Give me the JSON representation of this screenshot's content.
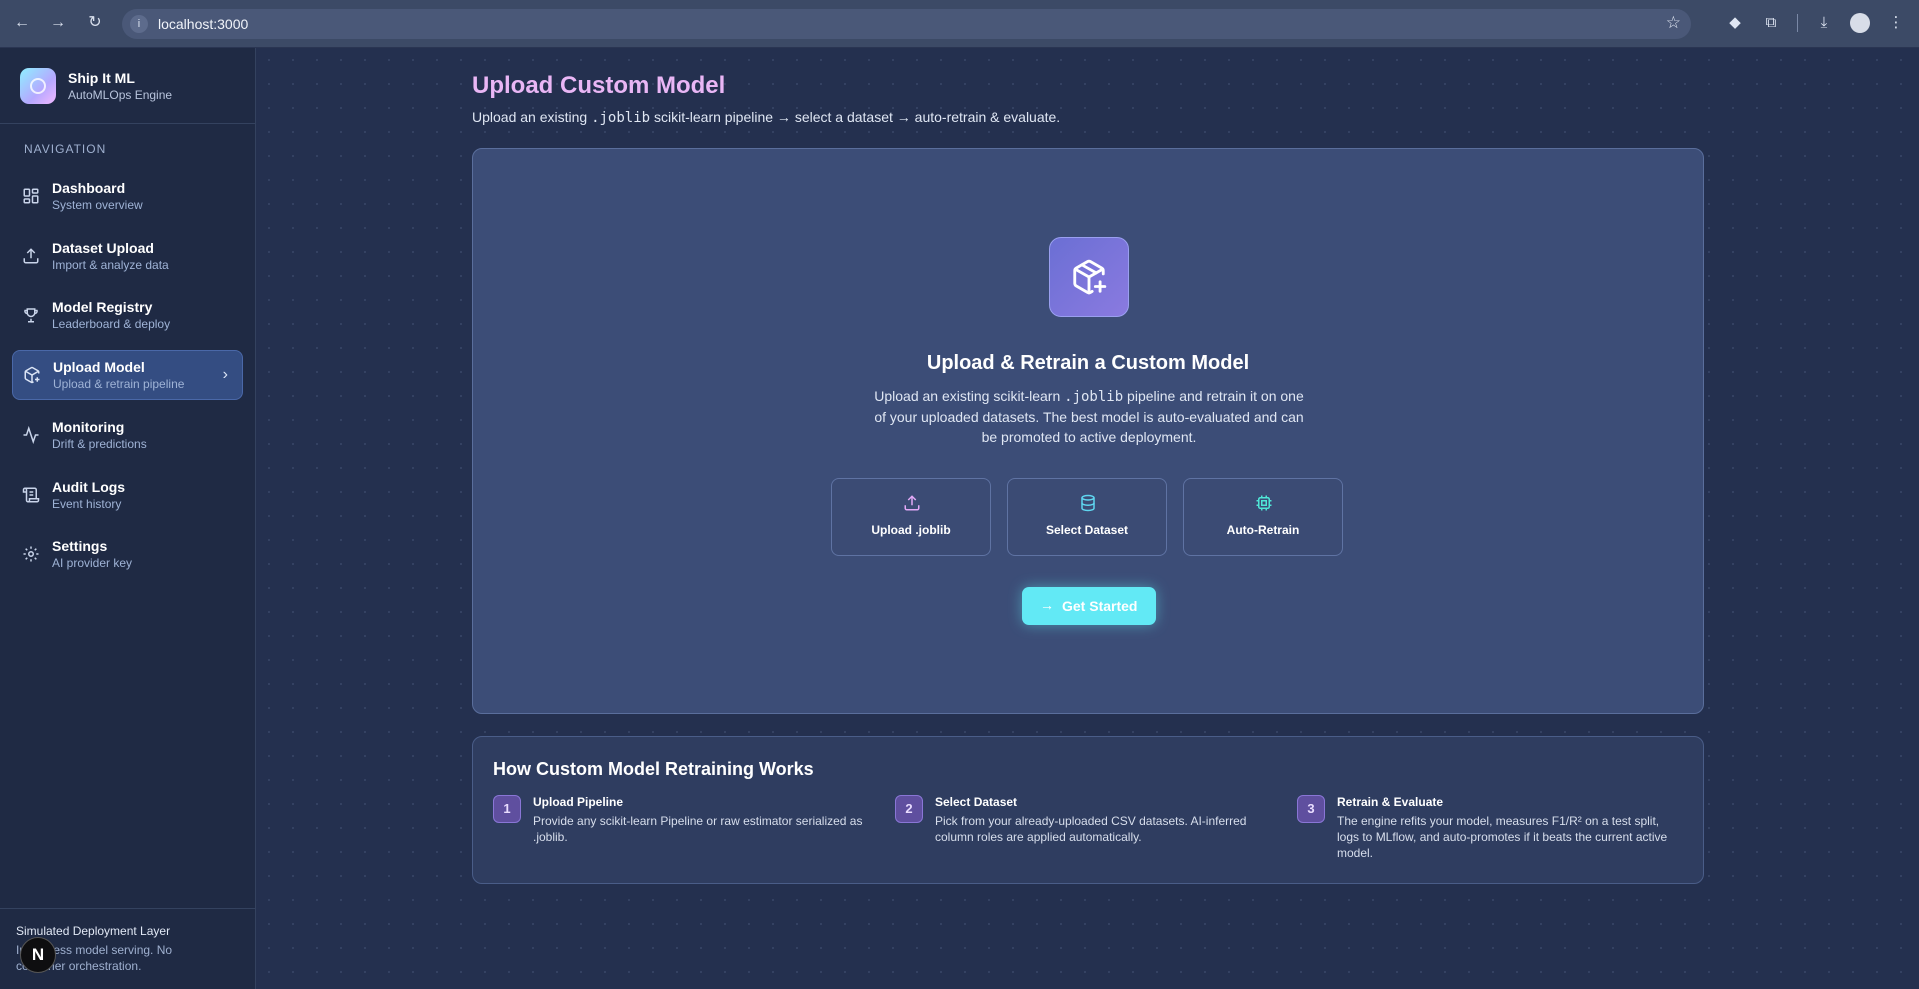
{
  "browser": {
    "url": "localhost:3000"
  },
  "sidebar": {
    "brand": {
      "title": "Ship It ML",
      "subtitle": "AutoMLOps Engine"
    },
    "nav_heading": "NAVIGATION",
    "items": [
      {
        "label": "Dashboard",
        "desc": "System overview",
        "icon": "dashboard-icon"
      },
      {
        "label": "Dataset Upload",
        "desc": "Import & analyze data",
        "icon": "upload-icon"
      },
      {
        "label": "Model Registry",
        "desc": "Leaderboard & deploy",
        "icon": "trophy-icon"
      },
      {
        "label": "Upload Model",
        "desc": "Upload & retrain pipeline",
        "icon": "package-plus-icon",
        "active": true
      },
      {
        "label": "Monitoring",
        "desc": "Drift & predictions",
        "icon": "activity-icon"
      },
      {
        "label": "Audit Logs",
        "desc": "Event history",
        "icon": "scroll-icon"
      },
      {
        "label": "Settings",
        "desc": "AI provider key",
        "icon": "gear-icon"
      }
    ],
    "footer": {
      "title": "Simulated Deployment Layer",
      "text": "In-process model serving. No container orchestration.",
      "badge": "N"
    }
  },
  "main": {
    "title": "Upload Custom Model",
    "subtitle": {
      "pre": "Upload an existing ",
      "code": ".joblib",
      "post": " scikit-learn pipeline → select a dataset → auto-retrain & evaluate."
    },
    "hero": {
      "title": "Upload & Retrain a Custom Model",
      "desc_pre": "Upload an existing scikit-learn ",
      "desc_code": ".joblib",
      "desc_post": " pipeline and retrain it on one of your uploaded datasets. The best model is auto-evaluated and can be promoted to active deployment."
    },
    "tiles": [
      {
        "label": "Upload .joblib",
        "icon": "upload-icon",
        "color": "#e2a9f7"
      },
      {
        "label": "Select Dataset",
        "icon": "database-icon",
        "color": "#5fd6f0"
      },
      {
        "label": "Auto-Retrain",
        "icon": "cpu-icon",
        "color": "#4fe6d6"
      }
    ],
    "cta_label": "Get Started",
    "how": {
      "title": "How Custom Model Retraining Works",
      "steps": [
        {
          "num": "1",
          "title": "Upload Pipeline",
          "desc": "Provide any scikit-learn Pipeline or raw estimator serialized as .joblib."
        },
        {
          "num": "2",
          "title": "Select Dataset",
          "desc": "Pick from your already-uploaded CSV datasets. AI-inferred column roles are applied automatically."
        },
        {
          "num": "3",
          "title": "Retrain & Evaluate",
          "desc": "The engine refits your model, measures F1/R² on a test split, logs to MLflow, and auto-promotes if it beats the current active model."
        }
      ]
    }
  },
  "colors": {
    "accent_title": "#e9b6f5",
    "cta": "#62e9f5",
    "active_nav": "#344d82"
  }
}
